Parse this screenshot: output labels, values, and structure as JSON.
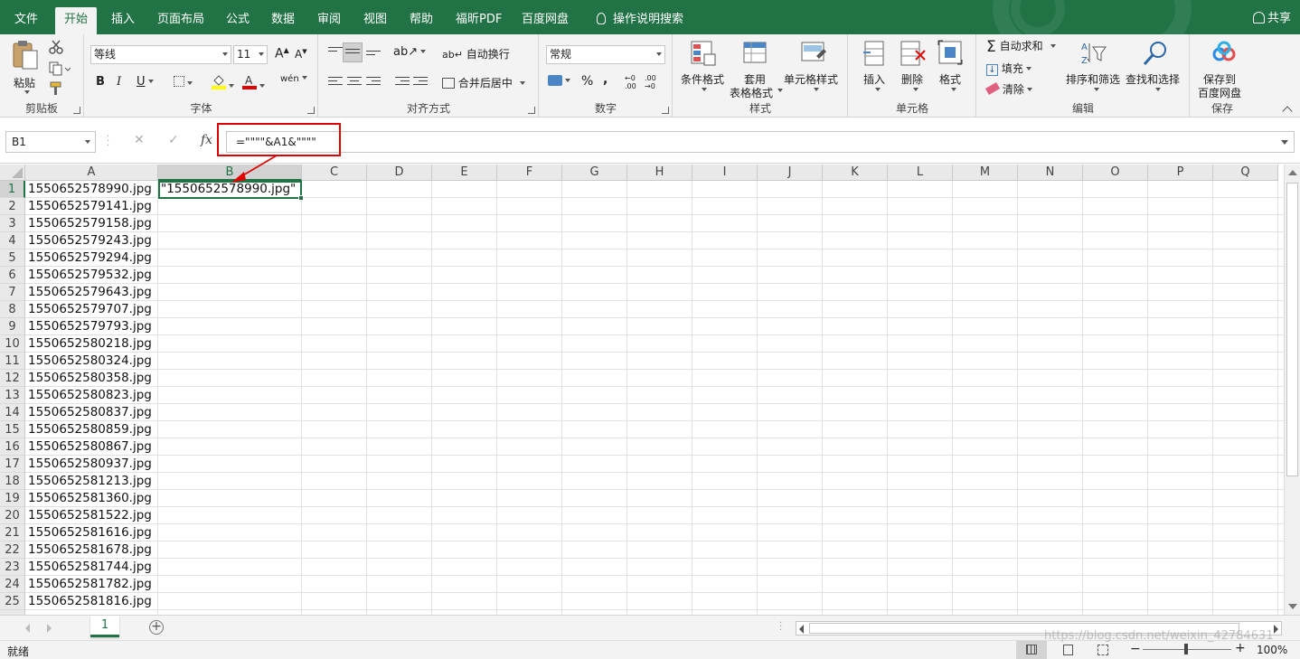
{
  "tabs": [
    "文件",
    "开始",
    "插入",
    "页面布局",
    "公式",
    "数据",
    "审阅",
    "视图",
    "帮助",
    "福昕PDF",
    "百度网盘",
    "操作说明搜索"
  ],
  "active_tab": "开始",
  "share_label": "共享",
  "ribbon": {
    "clipboard": {
      "label": "剪贴板",
      "paste": "粘贴"
    },
    "font": {
      "label": "字体",
      "font_name": "等线",
      "font_size": "11",
      "bold": "B",
      "italic": "I",
      "underline": "U",
      "grow": "A",
      "shrink": "A",
      "phonetic": "wén"
    },
    "alignment": {
      "label": "对齐方式",
      "wrap": "自动换行",
      "merge": "合并后居中"
    },
    "number": {
      "label": "数字",
      "format": "常规",
      "percent": "%",
      "comma": ","
    },
    "styles": {
      "label": "样式",
      "conditional": "条件格式",
      "table_format_1": "套用",
      "table_format_2": "表格格式",
      "cell_styles": "单元格样式"
    },
    "cells": {
      "label": "单元格",
      "insert": "插入",
      "delete": "删除",
      "format": "格式"
    },
    "editing": {
      "label": "编辑",
      "autosum": "自动求和",
      "fill": "填充",
      "clear": "清除",
      "sort_filter": "排序和筛选",
      "find_select": "查找和选择"
    },
    "save": {
      "label": "保存",
      "save_to_1": "保存到",
      "save_to_2": "百度网盘"
    }
  },
  "formula_bar": {
    "name_box": "B1",
    "fx": "fx",
    "formula": "=\"\"\"\"&A1&\"\"\"\""
  },
  "columns": [
    "A",
    "B",
    "C",
    "D",
    "E",
    "F",
    "G",
    "H",
    "I",
    "J",
    "K",
    "L",
    "M",
    "N",
    "O",
    "P",
    "Q"
  ],
  "rows": [
    {
      "n": "1",
      "a": "1550652578990.jpg",
      "b": "\"1550652578990.jpg\""
    },
    {
      "n": "2",
      "a": "1550652579141.jpg"
    },
    {
      "n": "3",
      "a": "1550652579158.jpg"
    },
    {
      "n": "4",
      "a": "1550652579243.jpg"
    },
    {
      "n": "5",
      "a": "1550652579294.jpg"
    },
    {
      "n": "6",
      "a": "1550652579532.jpg"
    },
    {
      "n": "7",
      "a": "1550652579643.jpg"
    },
    {
      "n": "8",
      "a": "1550652579707.jpg"
    },
    {
      "n": "9",
      "a": "1550652579793.jpg"
    },
    {
      "n": "10",
      "a": "1550652580218.jpg"
    },
    {
      "n": "11",
      "a": "1550652580324.jpg"
    },
    {
      "n": "12",
      "a": "1550652580358.jpg"
    },
    {
      "n": "13",
      "a": "1550652580823.jpg"
    },
    {
      "n": "14",
      "a": "1550652580837.jpg"
    },
    {
      "n": "15",
      "a": "1550652580859.jpg"
    },
    {
      "n": "16",
      "a": "1550652580867.jpg"
    },
    {
      "n": "17",
      "a": "1550652580937.jpg"
    },
    {
      "n": "18",
      "a": "1550652581213.jpg"
    },
    {
      "n": "19",
      "a": "1550652581360.jpg"
    },
    {
      "n": "20",
      "a": "1550652581522.jpg"
    },
    {
      "n": "21",
      "a": "1550652581616.jpg"
    },
    {
      "n": "22",
      "a": "1550652581678.jpg"
    },
    {
      "n": "23",
      "a": "1550652581744.jpg"
    },
    {
      "n": "24",
      "a": "1550652581782.jpg"
    },
    {
      "n": "25",
      "a": "1550652581816.jpg"
    }
  ],
  "sheet_tab": "1",
  "status": {
    "ready": "就绪",
    "zoom": "100%"
  },
  "watermark": "https://blog.csdn.net/weixin_42784631",
  "colors": {
    "accent": "#217346",
    "highlight": "#e00000"
  }
}
